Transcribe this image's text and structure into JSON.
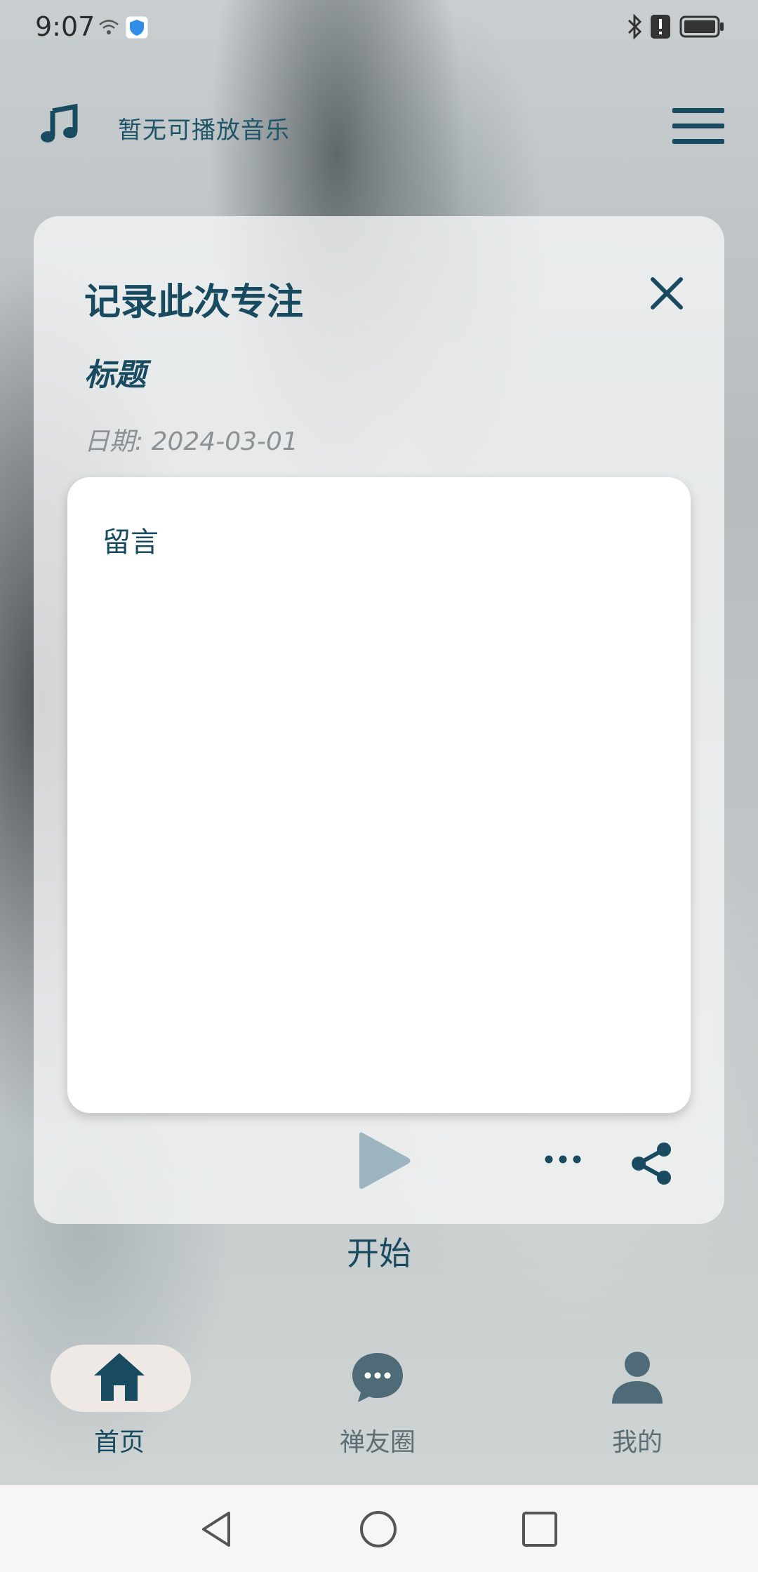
{
  "status_bar": {
    "time": "9:07",
    "icons": [
      "wifi-icon",
      "shield-app-icon",
      "bluetooth-icon",
      "alert-icon",
      "battery-icon"
    ]
  },
  "header": {
    "music_icon": "music-note-icon",
    "music_status": "暂无可播放音乐",
    "menu_icon": "hamburger-menu-icon"
  },
  "record_card": {
    "title": "记录此次专注",
    "close_icon": "close-icon",
    "subtitle": "标题",
    "date_label": "日期:",
    "date_value": "2024-03-01",
    "note_placeholder": "留言",
    "play_icon": "play-icon",
    "more_icon": "more-icon",
    "share_icon": "share-icon"
  },
  "start_label": "开始",
  "bottom_nav": {
    "items": [
      {
        "label": "首页",
        "icon": "home-icon",
        "active": true
      },
      {
        "label": "禅友圈",
        "icon": "chat-bubble-icon",
        "active": false
      },
      {
        "label": "我的",
        "icon": "user-icon",
        "active": false
      }
    ]
  },
  "system_nav": [
    "back-icon",
    "home-circle-icon",
    "recents-icon"
  ],
  "colors": {
    "primary": "#184b60",
    "muted": "#8a9296",
    "play_disabled": "#9db5c1",
    "card_bg": "#f4f5f5"
  }
}
